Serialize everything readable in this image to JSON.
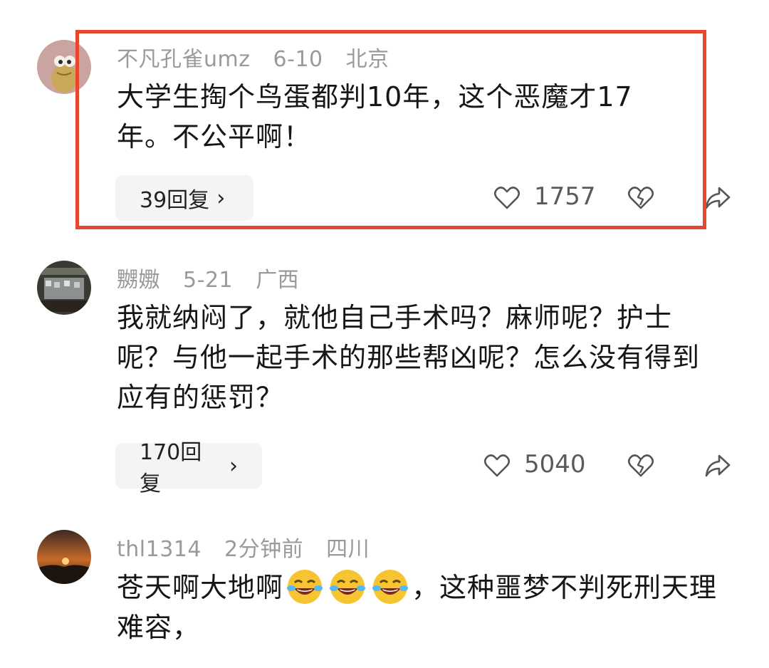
{
  "comments": [
    {
      "user": "不凡孔雀umz",
      "date": "6-10",
      "location": "北京",
      "text": "大学生掏个鸟蛋都判10年，这个恶魔才17年。不公平啊！",
      "replies": "39回复",
      "likes": "1757"
    },
    {
      "user": "嬲嫐",
      "date": "5-21",
      "location": "广西",
      "text": "我就纳闷了，就他自己手术吗？麻师呢？护士呢？与他一起手术的那些帮凶呢？怎么没有得到应有的惩罚？",
      "replies": "170回复",
      "likes": "5040"
    },
    {
      "user": "thl1314",
      "date": "2分钟前",
      "location": "四川",
      "text_before": "苍天啊大地啊",
      "text_after": "，这种噩梦不判死刑天理难容，"
    }
  ],
  "ui": {
    "chevron": "›"
  },
  "colors": {
    "highlight": "#e5482f",
    "meta": "#9a9a9a",
    "reply_bg": "#f4f4f4"
  }
}
